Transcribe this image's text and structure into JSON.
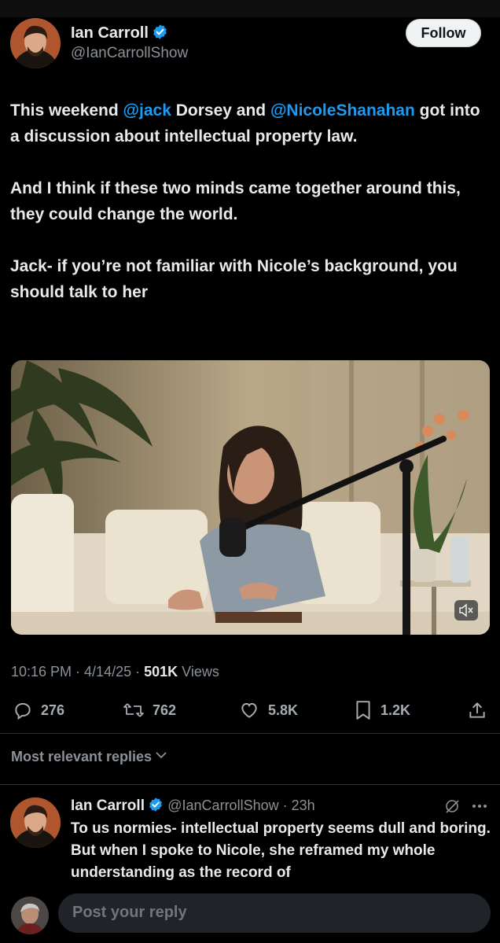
{
  "tweet": {
    "author_name": "Ian Carroll",
    "author_handle": "@IanCarrollShow",
    "follow_label": "Follow",
    "text": {
      "p1_a": "This weekend ",
      "p1_mention1": "@jack",
      "p1_b": " Dorsey and ",
      "p1_mention2": "@NicoleShanahan",
      "p1_c": " got into a discussion about intellectual property law.",
      "p2": "And I think if these two minds came together around this, they could change the world.",
      "p3": "Jack- if you’re not familiar with Nicole’s background, you should talk to her"
    },
    "time": "10:16 PM",
    "date": "4/14/25",
    "views_count": "501K",
    "views_label": "Views",
    "stats": {
      "replies": "276",
      "reposts": "762",
      "likes": "5.8K",
      "bookmarks": "1.2K"
    }
  },
  "replies_filter": "Most relevant replies",
  "reply": {
    "author_name": "Ian Carroll",
    "author_handle": "@IanCarrollShow",
    "age": "23h",
    "text": "To us normies- intellectual property seems dull and boring. But when I spoke to Nicole, she reframed my whole understanding as the record of"
  },
  "composer": {
    "placeholder": "Post your reply"
  },
  "colors": {
    "link": "#1d9bf0",
    "background": "#000000",
    "muted": "#8b9197"
  },
  "icons": [
    "verified-badge-icon",
    "mute-icon",
    "reply-icon",
    "repost-icon",
    "like-icon",
    "bookmark-icon",
    "share-icon",
    "chevron-down-icon",
    "grok-icon",
    "more-icon"
  ]
}
